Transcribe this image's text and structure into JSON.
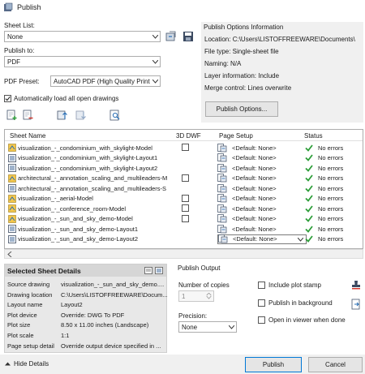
{
  "window": {
    "title": "Publish"
  },
  "sheet_list": {
    "label": "Sheet List:",
    "value": "None"
  },
  "publish_to": {
    "label": "Publish to:",
    "value": "PDF"
  },
  "pdf_preset": {
    "label": "PDF Preset:",
    "value": "AutoCAD PDF (High Quality Print)"
  },
  "auto_load": {
    "label": "Automatically load all open drawings",
    "checked": true
  },
  "publish_options_info": {
    "title": "Publish Options Information",
    "lines": [
      "Location: C:\\Users\\LISTOFFREEWARE\\Documents\\",
      "File type: Single-sheet file",
      "Naming: N/A",
      "Layer information: Include",
      "Merge control: Lines overwrite"
    ],
    "button": "Publish Options..."
  },
  "grid": {
    "headers": [
      "Sheet Name",
      "3D DWF",
      "Page Setup",
      "Status"
    ],
    "rows": [
      {
        "name": "visualization_-_condominium_with_skylight-Model",
        "dwf": true,
        "setup": "<Default: None>",
        "status": "No errors",
        "type": "model"
      },
      {
        "name": "visualization_-_condominium_with_skylight-Layout1",
        "dwf": false,
        "setup": "<Default: None>",
        "status": "No errors",
        "type": "layout"
      },
      {
        "name": "visualization_-_condominium_with_skylight-Layout2",
        "dwf": false,
        "setup": "<Default: None>",
        "status": "No errors",
        "type": "layout"
      },
      {
        "name": "architectural_-_annotation_scaling_and_multileaders-M",
        "dwf": true,
        "setup": "<Default: None>",
        "status": "No errors",
        "type": "model"
      },
      {
        "name": "architectural_-_annotation_scaling_and_multileaders-S",
        "dwf": false,
        "setup": "<Default: None>",
        "status": "No errors",
        "type": "layout"
      },
      {
        "name": "visualization_-_aerial-Model",
        "dwf": true,
        "setup": "<Default: None>",
        "status": "No errors",
        "type": "model"
      },
      {
        "name": "visualization_-_conference_room-Model",
        "dwf": true,
        "setup": "<Default: None>",
        "status": "No errors",
        "type": "model"
      },
      {
        "name": "visualization_-_sun_and_sky_demo-Model",
        "dwf": true,
        "setup": "<Default: None>",
        "status": "No errors",
        "type": "model"
      },
      {
        "name": "visualization_-_sun_and_sky_demo-Layout1",
        "dwf": false,
        "setup": "<Default: None>",
        "status": "No errors",
        "type": "layout"
      },
      {
        "name": "visualization_-_sun_and_sky_demo-Layout2",
        "dwf": false,
        "setup": "<Default: None>",
        "status": "No errors",
        "type": "layout",
        "selected": true
      }
    ]
  },
  "details": {
    "title": "Selected Sheet Details",
    "rows": [
      {
        "k": "Source drawing",
        "v": "visualization_-_sun_and_sky_demo...."
      },
      {
        "k": "Drawing location",
        "v": "C:\\Users\\LISTOFFREEWARE\\Docum..."
      },
      {
        "k": "Layout name",
        "v": "Layout2"
      },
      {
        "k": "Plot device",
        "v": "Override: DWG To PDF"
      },
      {
        "k": "Plot size",
        "v": "8.50 x 11.00 inches (Landscape)"
      },
      {
        "k": "Plot scale",
        "v": "1:1"
      },
      {
        "k": "Page setup detail",
        "v": "Override output device specified in ..."
      }
    ]
  },
  "output": {
    "title": "Publish Output",
    "copies_label": "Number of copies",
    "copies_value": "1",
    "precision_label": "Precision:",
    "precision_value": "None",
    "include_plot_stamp": "Include plot stamp",
    "publish_background": "Publish in background",
    "open_viewer": "Open in viewer when done"
  },
  "footer": {
    "hide_details": "Hide Details",
    "publish": "Publish",
    "cancel": "Cancel"
  },
  "colors": {
    "accent": "#0078d7",
    "check_green": "#2e9e3a"
  }
}
